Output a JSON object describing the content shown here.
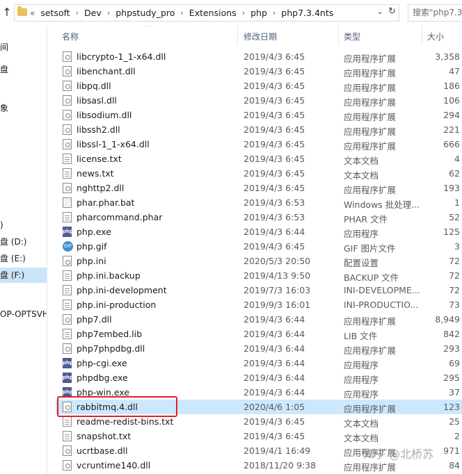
{
  "address_bar": {
    "lead": "«",
    "crumbs": [
      "setsoft",
      "Dev",
      "phpstudy_pro",
      "Extensions",
      "php",
      "php7.3.4nts"
    ],
    "dropdown_glyph": "⌄",
    "refresh_glyph": "↻"
  },
  "search": {
    "placeholder": "搜索\"php7.3"
  },
  "nav_pane": {
    "items": [
      {
        "label": "间"
      },
      {
        "label": "盘"
      },
      {
        "label": "象"
      },
      {
        "label": ")"
      },
      {
        "label": "盘 (D:)"
      },
      {
        "label": "盘 (E:)"
      },
      {
        "label": "盘 (F:)",
        "selected": true
      },
      {
        "label": "OP-OPTSVHD"
      }
    ]
  },
  "columns": {
    "name": "名称",
    "date": "修改日期",
    "type": "类型",
    "size": "大小"
  },
  "files": [
    {
      "name": "libcrypto-1_1-x64.dll",
      "date": "2019/4/3 6:45",
      "type": "应用程序扩展",
      "size": "3,358",
      "icon": "dll"
    },
    {
      "name": "libenchant.dll",
      "date": "2019/4/3 6:45",
      "type": "应用程序扩展",
      "size": "47",
      "icon": "dll"
    },
    {
      "name": "libpq.dll",
      "date": "2019/4/3 6:45",
      "type": "应用程序扩展",
      "size": "186",
      "icon": "dll"
    },
    {
      "name": "libsasl.dll",
      "date": "2019/4/3 6:45",
      "type": "应用程序扩展",
      "size": "106",
      "icon": "dll"
    },
    {
      "name": "libsodium.dll",
      "date": "2019/4/3 6:45",
      "type": "应用程序扩展",
      "size": "294",
      "icon": "dll"
    },
    {
      "name": "libssh2.dll",
      "date": "2019/4/3 6:45",
      "type": "应用程序扩展",
      "size": "221",
      "icon": "dll"
    },
    {
      "name": "libssl-1_1-x64.dll",
      "date": "2019/4/3 6:45",
      "type": "应用程序扩展",
      "size": "666",
      "icon": "dll"
    },
    {
      "name": "license.txt",
      "date": "2019/4/3 6:45",
      "type": "文本文档",
      "size": "4",
      "icon": "txt"
    },
    {
      "name": "news.txt",
      "date": "2019/4/3 6:45",
      "type": "文本文档",
      "size": "62",
      "icon": "txt"
    },
    {
      "name": "nghttp2.dll",
      "date": "2019/4/3 6:45",
      "type": "应用程序扩展",
      "size": "193",
      "icon": "dll"
    },
    {
      "name": "phar.phar.bat",
      "date": "2019/4/3 6:53",
      "type": "Windows 批处理...",
      "size": "1",
      "icon": "bat"
    },
    {
      "name": "pharcommand.phar",
      "date": "2019/4/3 6:53",
      "type": "PHAR 文件",
      "size": "52",
      "icon": "txt"
    },
    {
      "name": "php.exe",
      "date": "2019/4/3 6:44",
      "type": "应用程序",
      "size": "125",
      "icon": "php"
    },
    {
      "name": "php.gif",
      "date": "2019/4/3 6:45",
      "type": "GIF 图片文件",
      "size": "3",
      "icon": "gif"
    },
    {
      "name": "php.ini",
      "date": "2020/5/3 20:50",
      "type": "配置设置",
      "size": "72",
      "icon": "cfg"
    },
    {
      "name": "php.ini.backup",
      "date": "2019/4/13 9:50",
      "type": "BACKUP 文件",
      "size": "72",
      "icon": "txt"
    },
    {
      "name": "php.ini-development",
      "date": "2019/7/3 16:03",
      "type": "INI-DEVELOPME...",
      "size": "72",
      "icon": "txt"
    },
    {
      "name": "php.ini-production",
      "date": "2019/9/3 16:01",
      "type": "INI-PRODUCTIO...",
      "size": "73",
      "icon": "txt"
    },
    {
      "name": "php7.dll",
      "date": "2019/4/3 6:44",
      "type": "应用程序扩展",
      "size": "8,949",
      "icon": "dll"
    },
    {
      "name": "php7embed.lib",
      "date": "2019/4/3 6:44",
      "type": "LIB 文件",
      "size": "842",
      "icon": "txt"
    },
    {
      "name": "php7phpdbg.dll",
      "date": "2019/4/3 6:44",
      "type": "应用程序扩展",
      "size": "293",
      "icon": "dll"
    },
    {
      "name": "php-cgi.exe",
      "date": "2019/4/3 6:44",
      "type": "应用程序",
      "size": "69",
      "icon": "php"
    },
    {
      "name": "phpdbg.exe",
      "date": "2019/4/3 6:44",
      "type": "应用程序",
      "size": "295",
      "icon": "php"
    },
    {
      "name": "php-win.exe",
      "date": "2019/4/3 6:44",
      "type": "应用程序",
      "size": "37",
      "icon": "php"
    },
    {
      "name": "rabbitmq.4.dll",
      "date": "2020/4/6 1:05",
      "type": "应用程序扩展",
      "size": "123",
      "icon": "dll",
      "selected": true
    },
    {
      "name": "readme-redist-bins.txt",
      "date": "2019/4/3 6:45",
      "type": "文本文档",
      "size": "25",
      "icon": "txt"
    },
    {
      "name": "snapshot.txt",
      "date": "2019/4/3 6:45",
      "type": "文本文档",
      "size": "2",
      "icon": "txt"
    },
    {
      "name": "ucrtbase.dll",
      "date": "2019/4/1 16:49",
      "type": "应用程序扩展",
      "size": "971",
      "icon": "dll"
    },
    {
      "name": "vcruntime140.dll",
      "date": "2018/11/20 9:38",
      "type": "应用程序扩展",
      "size": "84",
      "icon": "dll"
    }
  ],
  "watermark": "知乎 @北桥苏",
  "colors": {
    "selection": "#cce8ff",
    "nav_selection": "#cce4f7",
    "highlight_border": "#e02020",
    "header_text": "#4c607a"
  }
}
